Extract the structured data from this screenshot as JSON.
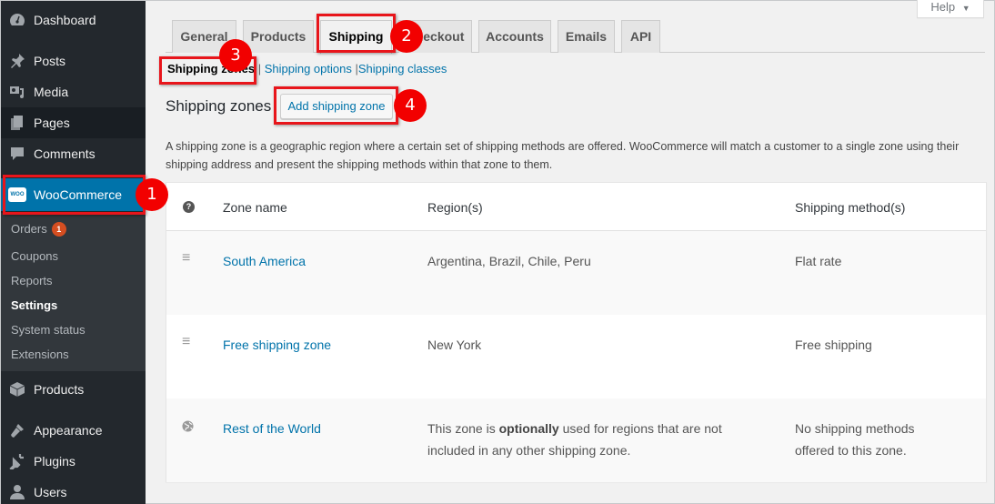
{
  "sidebar": {
    "items": [
      {
        "label": "Dashboard",
        "icon": "dashboard-icon"
      },
      {
        "label": "Posts",
        "icon": "pin-icon"
      },
      {
        "label": "Media",
        "icon": "media-icon"
      },
      {
        "label": "Pages",
        "icon": "pages-icon"
      },
      {
        "label": "Comments",
        "icon": "comment-icon"
      },
      {
        "label": "WooCommerce",
        "icon": "woo-icon"
      },
      {
        "label": "Products",
        "icon": "box-icon"
      },
      {
        "label": "Appearance",
        "icon": "brush-icon"
      },
      {
        "label": "Plugins",
        "icon": "plug-icon"
      },
      {
        "label": "Users",
        "icon": "user-icon"
      }
    ],
    "woo_icon_text": "WOO",
    "submenu": [
      {
        "label": "Orders",
        "badge": "1"
      },
      {
        "label": "Coupons"
      },
      {
        "label": "Reports"
      },
      {
        "label": "Settings",
        "active": true
      },
      {
        "label": "System status"
      },
      {
        "label": "Extensions"
      }
    ]
  },
  "help": {
    "label": "Help",
    "arrow": "▼"
  },
  "tabs": [
    {
      "label": "General"
    },
    {
      "label": "Products"
    },
    {
      "label": "Shipping",
      "active": true
    },
    {
      "label": "Checkout"
    },
    {
      "label": "Accounts"
    },
    {
      "label": "Emails"
    },
    {
      "label": "API"
    }
  ],
  "subsubsub": {
    "current": "Shipping zones",
    "links": [
      "Shipping options",
      "Shipping classes"
    ],
    "separator": "|"
  },
  "heading": "Shipping zones",
  "add_button": "Add shipping zone",
  "description": "A shipping zone is a geographic region where a certain set of shipping methods are offered. WooCommerce will match a customer to a single zone using their shipping address and present the shipping methods within that zone to them.",
  "table": {
    "help_icon": "?",
    "headers": [
      "Zone name",
      "Region(s)",
      "Shipping method(s)"
    ],
    "rows": [
      {
        "icon": "drag-handle-icon",
        "glyph": "≡",
        "zone": "South America",
        "regions": "Argentina, Brazil, Chile, Peru",
        "methods": "Flat rate"
      },
      {
        "icon": "drag-handle-icon",
        "glyph": "≡",
        "zone": "Free shipping zone",
        "regions": "New York",
        "methods": "Free shipping"
      },
      {
        "icon": "globe-icon",
        "glyph": "🌐",
        "zone": "Rest of the World",
        "regions_pre": "This zone is ",
        "regions_bold": "optionally",
        "regions_post": " used for regions that are not included in any other shipping zone.",
        "methods": "No shipping methods offered to this zone."
      }
    ]
  },
  "annotations": {
    "colors": {
      "highlight": "#e8151b",
      "marker": "#f20000"
    },
    "markers": [
      "1",
      "2",
      "3",
      "4"
    ]
  }
}
